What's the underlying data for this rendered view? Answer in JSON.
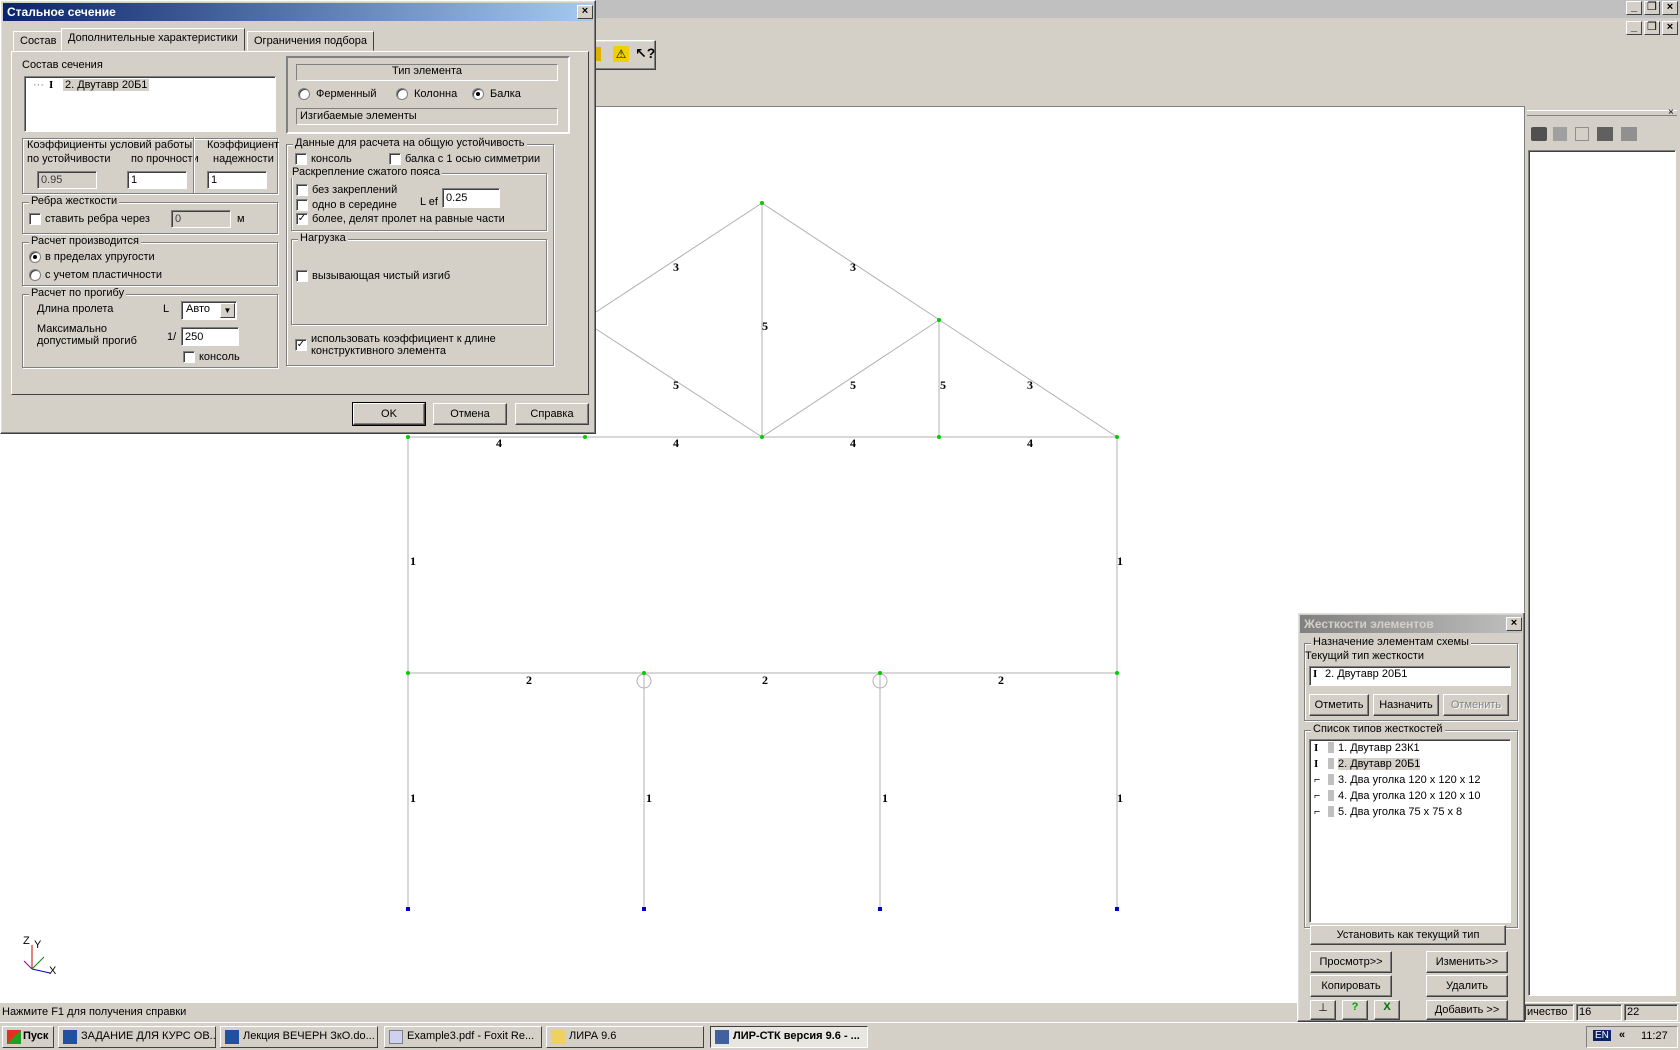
{
  "dialog": {
    "title": "Стальное сечение",
    "tabs": [
      "Состав",
      "Дополнительные характеристики",
      "Ограничения подбора"
    ],
    "section_composition": {
      "label": "Состав сечения",
      "item": "2. Двутавр 20Б1"
    },
    "coeff": {
      "label_work": "Коэффициенты условий работы",
      "label_stability": "по устойчивости",
      "label_strength": "по прочности",
      "label_reliability_1": "Коэффициент",
      "label_reliability_2": "надежности",
      "stability_value": "0.95",
      "strength_value": "1",
      "reliability_value": "1"
    },
    "ribs": {
      "label": "Ребра жесткости",
      "checkbox_label": "ставить ребра через",
      "value": "0",
      "unit": "м"
    },
    "calc": {
      "label": "Расчет производится",
      "option_elastic": "в пределах упругости",
      "option_plastic": "с учетом пластичности"
    },
    "deflection": {
      "label": "Расчет по прогибу",
      "span_label": "Длина пролета",
      "span_prefix": "L",
      "span_value": "Авто",
      "max_label_1": "Максимально",
      "max_label_2": "допустимый прогиб",
      "max_prefix": "1/",
      "max_value": "250",
      "console_label": "консоль"
    },
    "element_type": {
      "label": "Тип элемента",
      "option_truss": "Ферменный",
      "option_column": "Колонна",
      "option_beam": "Балка",
      "status": "Изгибаемые элементы"
    },
    "stability": {
      "label": "Данные для расчета на общую устойчивость",
      "console": "консоль",
      "beam_symmetry": "балка с 1 осью симметрии",
      "bracing_label": "Раскрепление сжатого пояса",
      "no_bracing": "без закреплений",
      "one_middle": "одно в середине",
      "more": "более, делят пролет на равные части",
      "lef_label": "L ef",
      "lef_value": "0.25"
    },
    "load": {
      "label": "Нагрузка",
      "pure_bending": "вызывающая чистый изгиб"
    },
    "use_coeff_1": "использовать коэффициент к длине",
    "use_coeff_2": "конструктивного элемента",
    "buttons": {
      "ok": "OK",
      "cancel": "Отмена",
      "help": "Справка"
    }
  },
  "stiffness_panel": {
    "title": "Жесткости элементов",
    "assign_label": "Назначение элементам схемы",
    "current_label": "Текущий тип жесткости",
    "current_value": "2. Двутавр 20Б1",
    "btn_mark": "Отметить",
    "btn_assign": "Назначить",
    "btn_cancel": "Отменить",
    "list_label": "Список типов жесткостей",
    "items": [
      "1. Двутавр 23К1",
      "2. Двутавр 20Б1",
      "3. Два уголка 120 x 120 x 12",
      "4. Два уголка 120 x 120 x 10",
      "5. Два уголка 75 x 75 x 8"
    ],
    "btn_set_current": "Установить как текущий тип",
    "btn_view": "Просмотр>>",
    "btn_change": "Изменить>>",
    "btn_copy": "Копировать",
    "btn_delete": "Удалить",
    "btn_add": "Добавить >>"
  },
  "canvas": {
    "labels": [
      "4",
      "4",
      "4",
      "4",
      "3",
      "3",
      "5",
      "5",
      "5",
      "5",
      "3",
      "1",
      "1",
      "2",
      "2",
      "2",
      "1",
      "1",
      "1",
      "1"
    ],
    "axes": {
      "x": "X",
      "y": "Y",
      "z": "Z"
    }
  },
  "statusbar": {
    "hint": "Нажмите F1 для получения справки",
    "count_label": "ичество",
    "value1": "16",
    "value2": "22"
  },
  "taskbar": {
    "start": "Пуск",
    "items": [
      "ЗАДАНИЕ ДЛЯ КУРС ОВ...",
      "Лекция ВЕЧЕРН ЗкО.do...",
      "Example3.pdf - Foxit Re...",
      "ЛИРА 9.6",
      "ЛИР-СТК версия 9.6 - ..."
    ],
    "lang": "EN",
    "chev": "«",
    "time": "11:27"
  },
  "colors": {
    "title_active": "#0a246a",
    "node": "#00cc00",
    "support": "#0000cc"
  }
}
